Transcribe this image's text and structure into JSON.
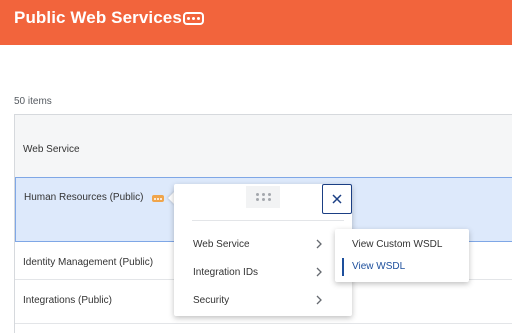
{
  "header": {
    "title": "Public Web Services",
    "background_color": "#f2643c",
    "more_icon": "ellipsis-icon"
  },
  "list": {
    "count_label": "50 items",
    "column_header": "Web Service",
    "rows": [
      {
        "label": "Human Resources (Public)",
        "selected": true
      },
      {
        "label": "Identity Management (Public)",
        "selected": false
      },
      {
        "label": "Integrations (Public)",
        "selected": false
      }
    ]
  },
  "related_actions_menu": {
    "drag_icon": "drag-handle-icon",
    "close_icon": "close-icon",
    "items": [
      {
        "label": "Web Service",
        "has_submenu": true
      },
      {
        "label": "Integration IDs",
        "has_submenu": true
      },
      {
        "label": "Security",
        "has_submenu": true
      }
    ]
  },
  "submenu": {
    "items": [
      {
        "label": "View Custom WSDL",
        "active": false
      },
      {
        "label": "View WSDL",
        "active": true
      }
    ]
  },
  "colors": {
    "selected_row": "#dde9fb",
    "accent_blue": "#1d4f9c",
    "related_actions_badge": "#f0a54b"
  }
}
